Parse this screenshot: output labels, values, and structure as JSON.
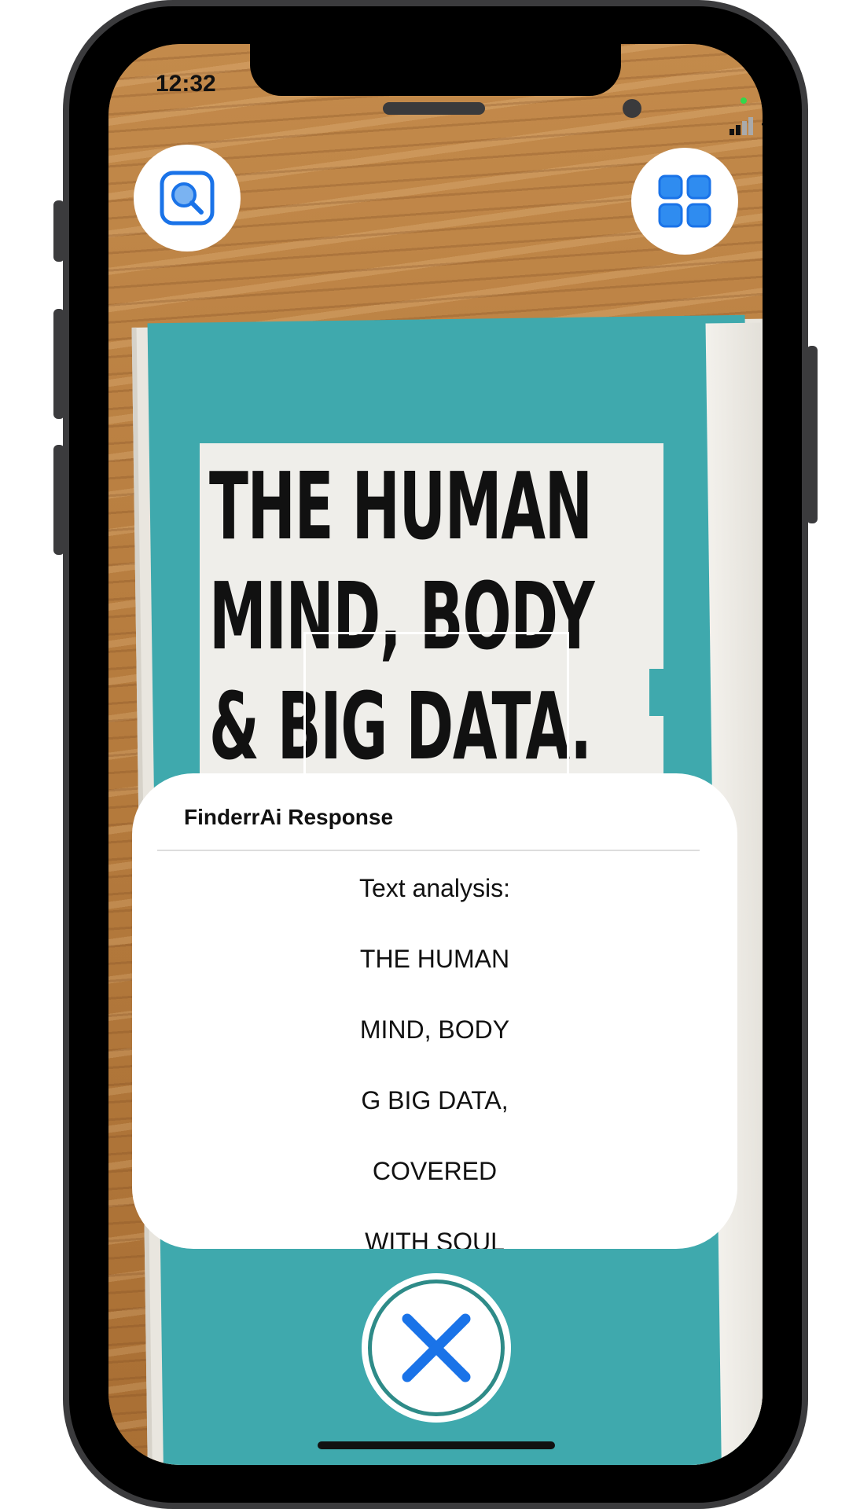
{
  "status_bar": {
    "time": "12:32",
    "icons": [
      "signal-icon",
      "wifi-icon",
      "battery-icon"
    ]
  },
  "toolbar": {
    "left_button_icon": "search-icon",
    "right_button_icon": "grid-icon"
  },
  "camera_view": {
    "cover_lines": [
      "THE HUMAN",
      "MIND, BODY",
      "& BIG DATA."
    ]
  },
  "response_card": {
    "title": "FinderrAi Response",
    "lines": [
      "Text analysis:",
      "THE HUMAN",
      "MIND, BODY",
      "G BIG DATA,",
      "COVERED",
      "WITH SOUL"
    ]
  },
  "close_button": {
    "icon": "close-icon"
  },
  "colors": {
    "accent": "#1a73e8",
    "ring": "#2e8b88",
    "cover": "#3fa9ad"
  }
}
